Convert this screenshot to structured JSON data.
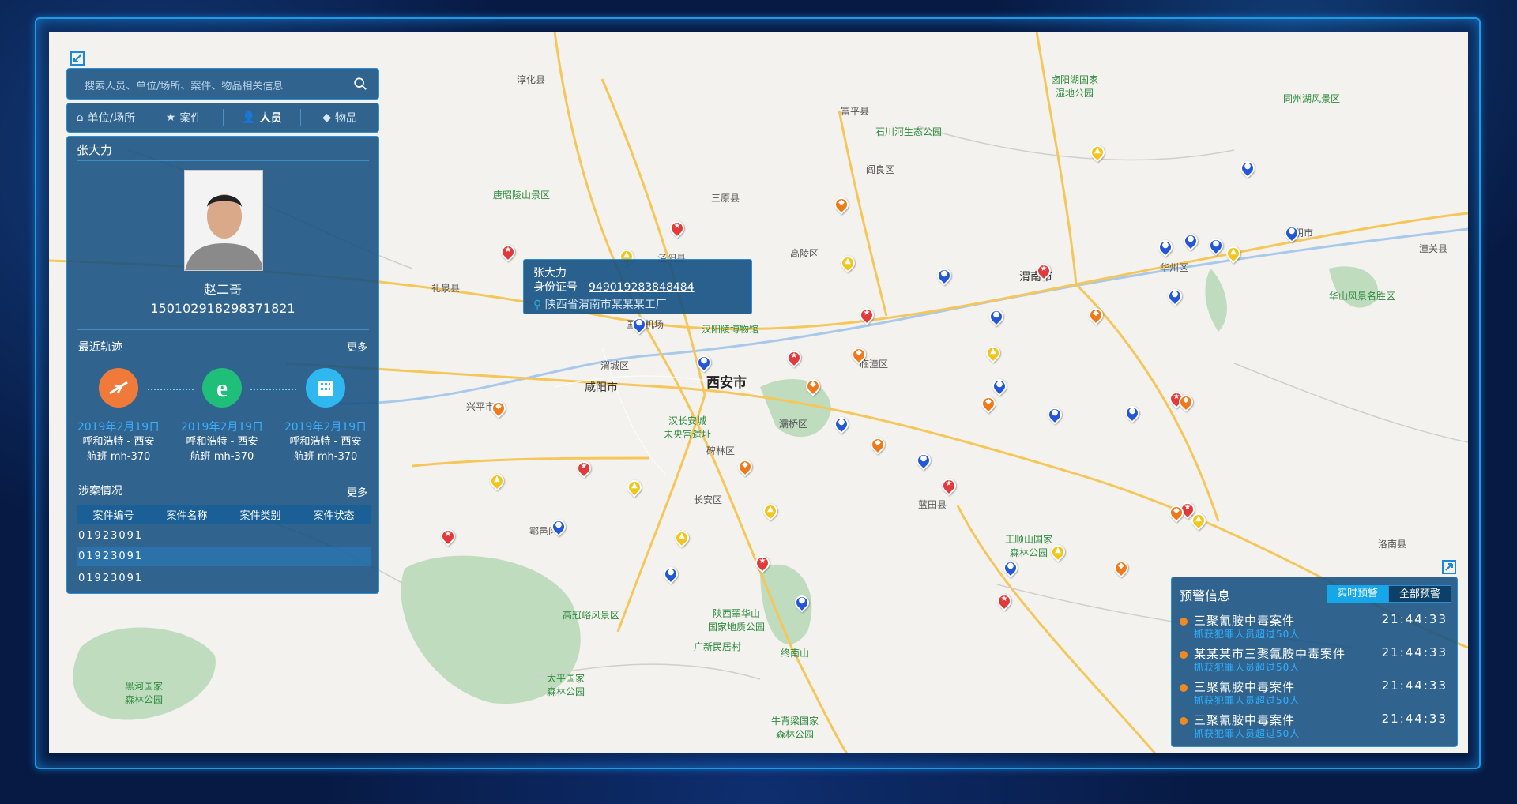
{
  "search": {
    "placeholder": "搜索人员、单位/场所、案件、物品相关信息"
  },
  "tabs": [
    {
      "label": "单位/场所",
      "icon": "home-icon"
    },
    {
      "label": "案件",
      "icon": "star-icon"
    },
    {
      "label": "人员",
      "icon": "user-icon",
      "active": true
    },
    {
      "label": "物品",
      "icon": "diamond-icon"
    }
  ],
  "person": {
    "name": "张大力",
    "alias": "赵二哥",
    "id_number": "150102918298371821"
  },
  "recent_track": {
    "title": "最近轨迹",
    "more": "更多",
    "items": [
      {
        "icon": "plane-icon",
        "date": "2019年2月19日",
        "route": "呼和浩特 - 西安",
        "flight": "航班 mh-370",
        "color": "#f07a3a"
      },
      {
        "icon": "internet-explorer-icon",
        "date": "2019年2月19日",
        "route": "呼和浩特 - 西安",
        "flight": "航班 mh-370",
        "color": "#1fbf7a"
      },
      {
        "icon": "building-icon",
        "date": "2019年2月19日",
        "route": "呼和浩特 - 西安",
        "flight": "航班 mh-370",
        "color": "#2fb8f0"
      }
    ]
  },
  "cases": {
    "title": "涉案情况",
    "more": "更多",
    "columns": [
      "案件编号",
      "案件名称",
      "案件类别",
      "案件状态"
    ],
    "rows": [
      [
        "01923091",
        "",
        "",
        ""
      ],
      [
        "01923091",
        "",
        "",
        ""
      ],
      [
        "01923091",
        "",
        "",
        ""
      ]
    ]
  },
  "popup": {
    "name": "张大力",
    "id_label": "身份证号",
    "id_value": "949019283848484",
    "address": "陕西省渭南市某某某工厂"
  },
  "warning": {
    "title": "预警信息",
    "tab_realtime": "实时预警",
    "tab_all": "全部预警",
    "items": [
      {
        "title": "三聚氰胺中毒案件",
        "time": "21:44:33",
        "sub": "抓获犯罪人员超过50人"
      },
      {
        "title": "某某某市三聚氰胺中毒案件",
        "time": "21:44:33",
        "sub": "抓获犯罪人员超过50人"
      },
      {
        "title": "三聚氰胺中毒案件",
        "time": "21:44:33",
        "sub": "抓获犯罪人员超过50人"
      },
      {
        "title": "三聚氰胺中毒案件",
        "time": "21:44:33",
        "sub": "抓获犯罪人员超过50人"
      }
    ]
  },
  "map": {
    "labels": {
      "xian": "西安市",
      "xianyang": "咸阳市",
      "weinan": "渭南市",
      "chunhua": "淳化县",
      "sanyuan": "三原县",
      "fuping": "富平县",
      "yanliang": "阎良区",
      "gaoling": "高陵区",
      "lintong": "临潼区",
      "baqiao": "灞桥区",
      "beilin": "碑林区",
      "changan": "长安区",
      "lantian": "蓝田县",
      "huyi": "鄠邑区",
      "weicheng": "渭城区",
      "xingping": "兴平市",
      "liquan": "礼泉县",
      "huazhou": "华州区",
      "huayin": "华阴市",
      "tongguan": "潼关县",
      "luonan": "洛南县",
      "jingyang": "泾阳县",
      "airport": "国际机场",
      "hanyang": "汉阳陵博物馆",
      "weiyang": "汉长安城\n未央宫遗址",
      "tangzhao": "唐昭陵山景区",
      "shichuan": "石川河生态公园",
      "lvyang": "卤阳湖国家\n湿地公园",
      "tongzhou": "同州湖风景区",
      "huashan": "华山风景名胜区",
      "cuihua": "陕西翠华山\n国家地质公园",
      "guangxin": "广新民居村",
      "zhongnan": "终南山",
      "niubei": "牛背梁国家\n森林公园",
      "taiping": "太平国家\n森林公园",
      "gaoguanyu": "高冠峪风景区",
      "heihe": "黑河国家\n森林公园",
      "wangshun": "王顺山国家\n森林公园"
    }
  }
}
